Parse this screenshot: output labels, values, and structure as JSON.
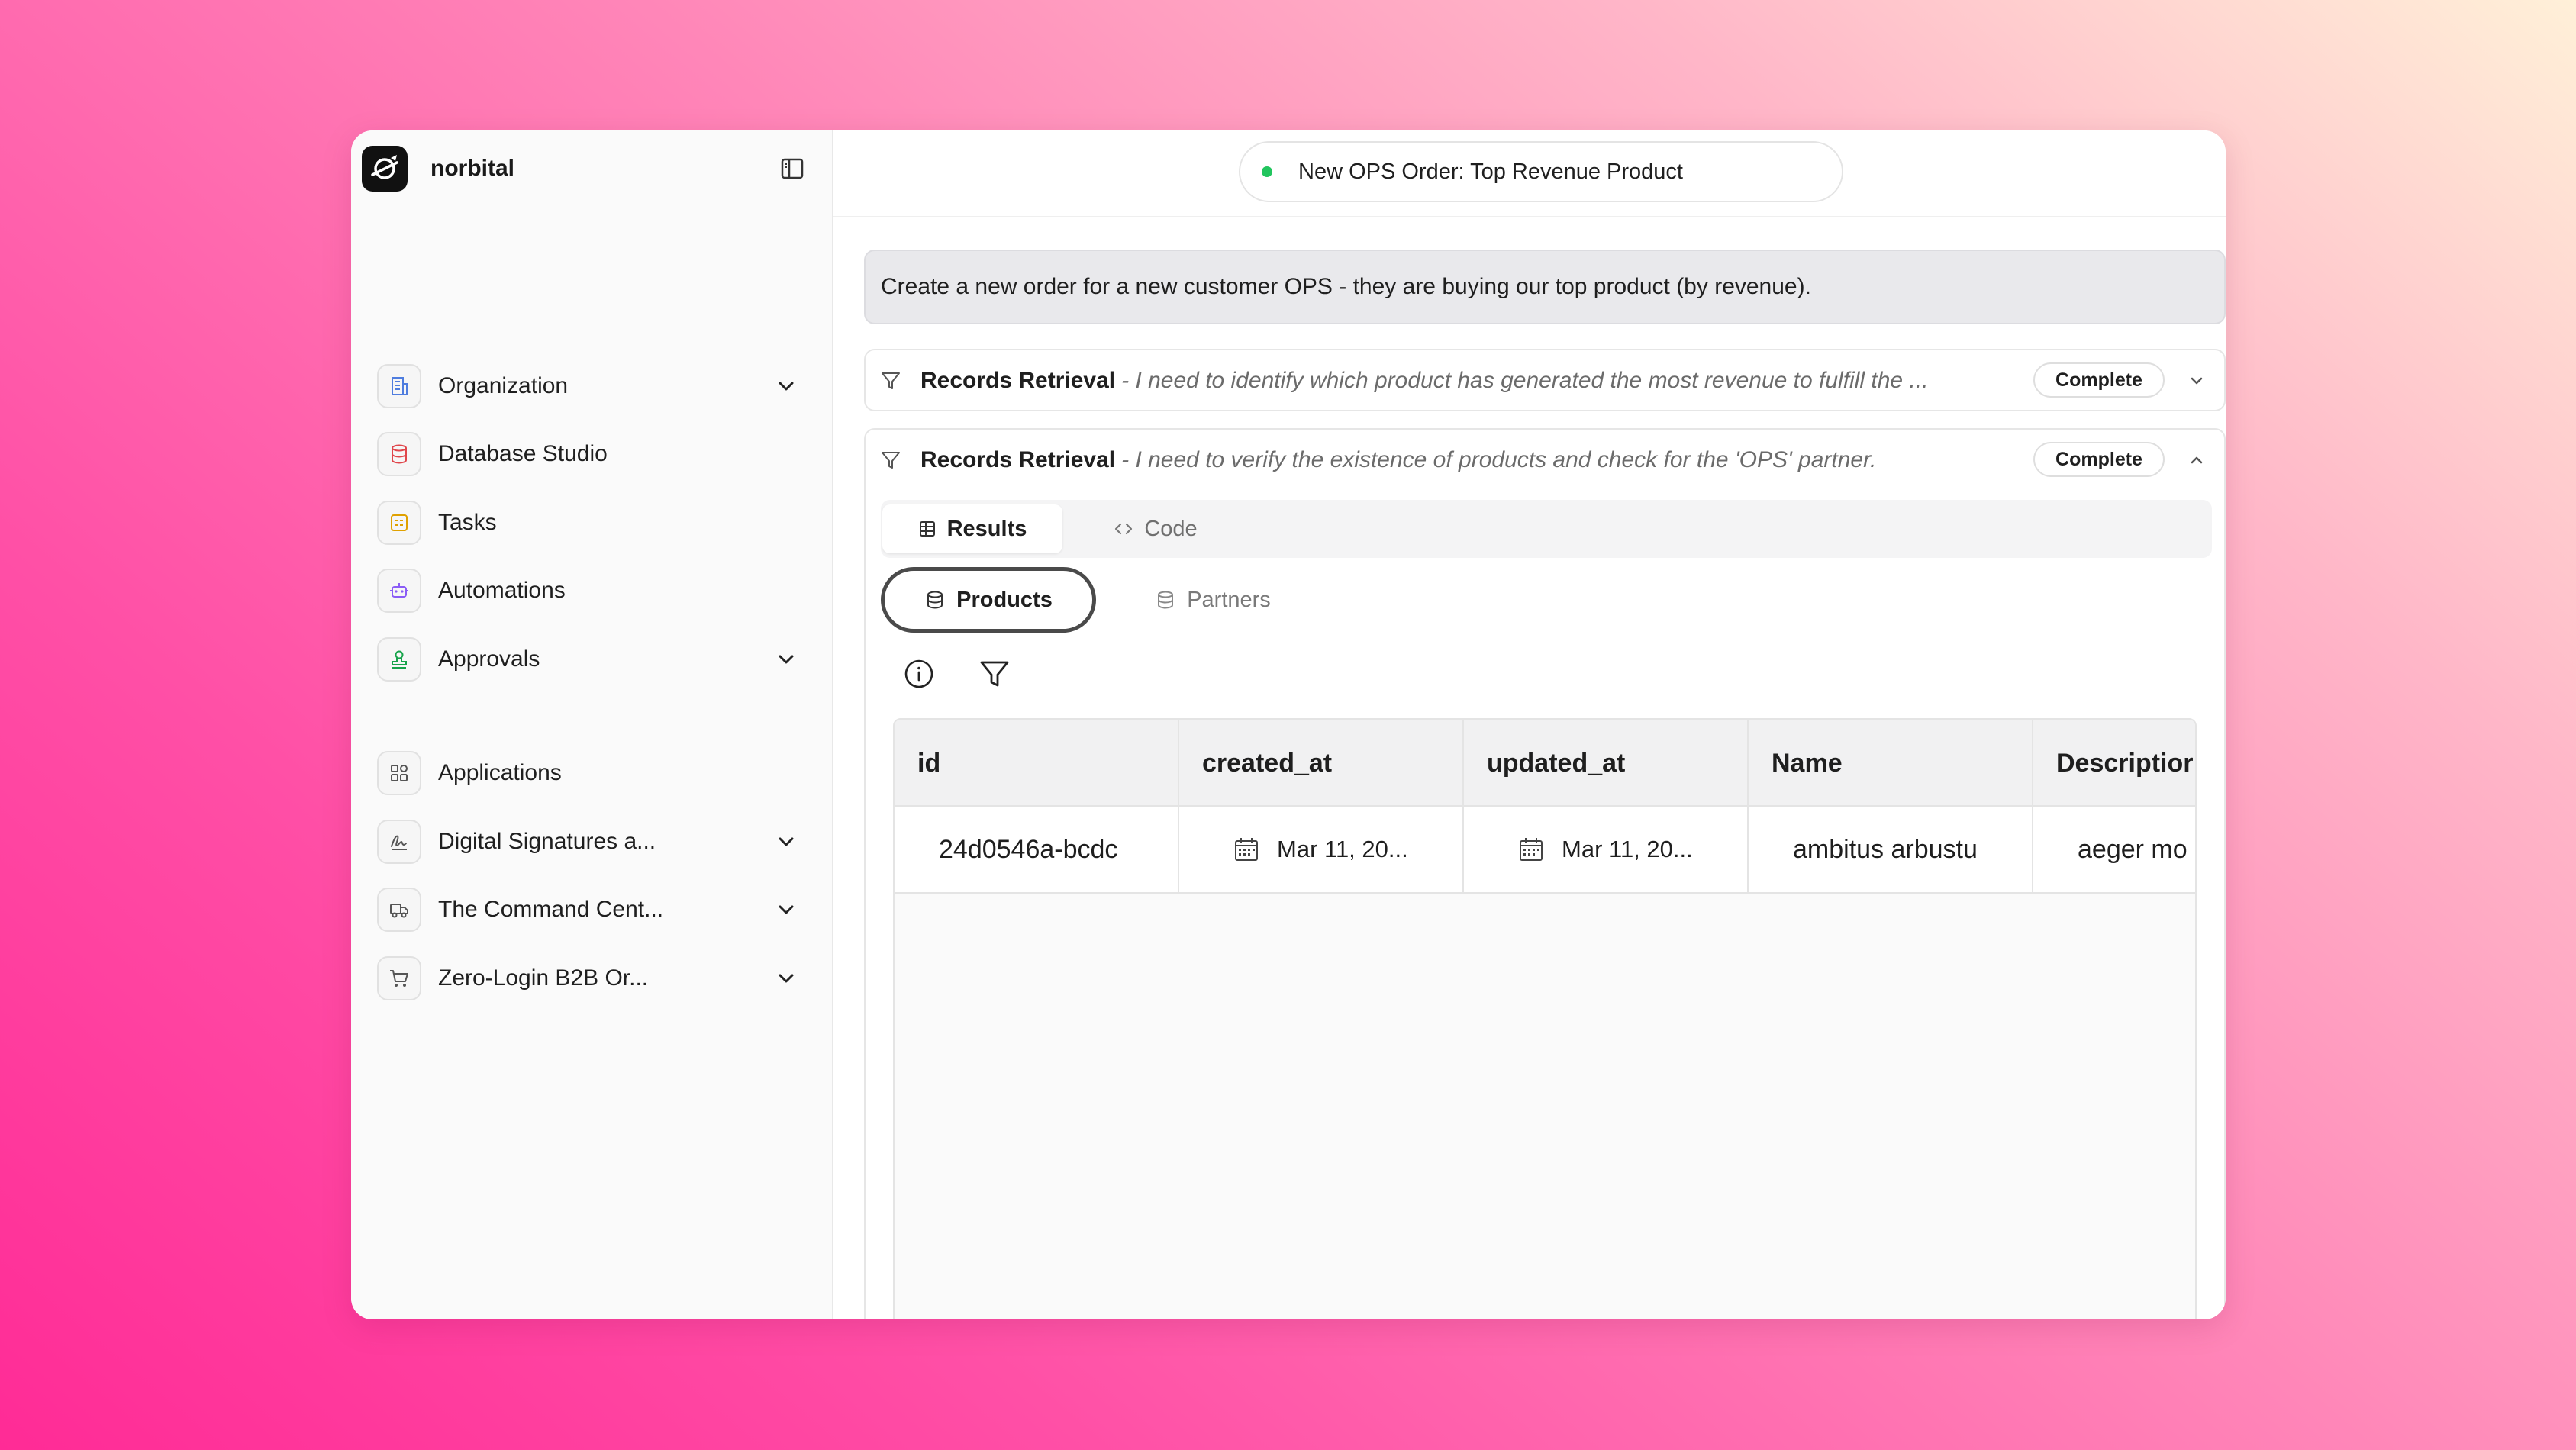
{
  "app": {
    "brand_name": "norbital",
    "title": "New OPS Order: Top Revenue Product"
  },
  "sidebar": {
    "items": [
      {
        "label": "Organization",
        "icon": "building-icon",
        "expandable": true
      },
      {
        "label": "Database Studio",
        "icon": "database-icon",
        "expandable": false
      },
      {
        "label": "Tasks",
        "icon": "tasks-icon",
        "expandable": false
      },
      {
        "label": "Automations",
        "icon": "robot-icon",
        "expandable": false
      },
      {
        "label": "Approvals",
        "icon": "stamp-icon",
        "expandable": true
      },
      {
        "label": "Applications",
        "icon": "apps-grid-icon",
        "expandable": false
      },
      {
        "label": "Digital Signatures a...",
        "icon": "signature-icon",
        "expandable": true
      },
      {
        "label": "The Command Cent...",
        "icon": "truck-icon",
        "expandable": true
      },
      {
        "label": "Zero-Login B2B Or...",
        "icon": "cart-icon",
        "expandable": true
      }
    ]
  },
  "conversation": {
    "prompt": "Create a new order for a new customer OPS - they are buying our top product (by revenue).",
    "steps": [
      {
        "title": "Records Retrieval",
        "description": "- I need to identify which product has generated the most revenue to fulfill the ...",
        "status": "Complete"
      },
      {
        "title": "Records Retrieval",
        "description": "- I need to verify the existence of products and check for the 'OPS' partner.",
        "status": "Complete"
      }
    ]
  },
  "results": {
    "tabs": [
      "Results",
      "Code"
    ],
    "active_tab": "Results",
    "sources": [
      "Products",
      "Partners"
    ],
    "active_source": "Products",
    "columns": [
      "id",
      "created_at",
      "updated_at",
      "Name",
      "Descriptior"
    ],
    "rows": [
      {
        "id": "24d0546a-bcdс",
        "created_at": "Mar 11, 20...",
        "updated_at": "Mar 11, 20...",
        "name": "ambitus arbustu",
        "description": "aeger mo"
      }
    ]
  },
  "colors": {
    "status_dot": "#22c55e",
    "database_icon": "#e0464b",
    "tasks_icon": "#e0a100",
    "automations_icon": "#8b5cf6",
    "approvals_icon": "#16a34a",
    "organization_icon": "#4f7ddf"
  }
}
